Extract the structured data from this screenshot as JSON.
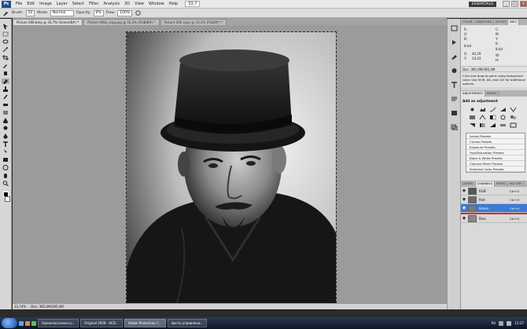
{
  "menubar": {
    "logo": "Ps",
    "items": [
      "File",
      "Edit",
      "Image",
      "Layer",
      "Select",
      "Filter",
      "Analysis",
      "3D",
      "View",
      "Window",
      "Help"
    ],
    "zoom": "33,7",
    "workspace": "ESSENTIALS",
    "window_buttons": [
      "_",
      "□",
      "×"
    ]
  },
  "options": {
    "brush_label": "Brush:",
    "brush_size": "10",
    "mode_label": "Mode:",
    "mode_value": "Normal",
    "opacity_label": "Opacity:",
    "opacity_value": "0%",
    "flow_label": "Flow:",
    "flow_value": "100%"
  },
  "tabs": [
    {
      "label": "Picture 006.bmp @ 33,7% (Green/8#) *"
    },
    {
      "label": "Picture 006a_copy.jpg @ 33,3% (RGB/8#) *"
    },
    {
      "label": "Picture 006 copy @ 33,3% (RGB/8*) *"
    }
  ],
  "status": {
    "zoom": "33,74%",
    "doc": "Doc: 385,0M/385,0M"
  },
  "panels": {
    "top_tabs": [
      "COLOR",
      "SWATCHES",
      "STYLES",
      "INFO"
    ],
    "info": {
      "r": "R:",
      "g": "G:",
      "b": "B:",
      "c": "C:",
      "m": "M:",
      "y": "Y:",
      "k": "K:",
      "bit_left": "8-bit",
      "bit_right": "8-bit",
      "x": "X:",
      "y_coord": "Y:",
      "x_val": "40,29",
      "y_val": "14,43",
      "w": "W:",
      "h": "H:"
    },
    "doc_line": "Doc: 385,0M/385,0M",
    "hint": "Click and drag to paint using foreground color. Use Shift, Alt, and Ctrl for additional options.",
    "adj_tabs": [
      "ADJUSTMENTS",
      "MASKS"
    ],
    "adj_title": "Add an adjustment",
    "presets": [
      "Levels Presets",
      "Curves Presets",
      "Exposure Presets",
      "Hue/Saturation Presets",
      "Black & White Presets",
      "Channel Mixer Presets",
      "Selective Color Presets"
    ],
    "ch_tabs": [
      "LAYERS",
      "CHANNELS",
      "PATHS",
      "HISTORY"
    ],
    "channels": [
      {
        "name": "RGB",
        "key": "Ctrl+2"
      },
      {
        "name": "Red",
        "key": "Ctrl+3"
      },
      {
        "name": "Green",
        "key": "Ctrl+4"
      },
      {
        "name": "Blue",
        "key": "Ctrl+5"
      }
    ]
  },
  "taskbar": {
    "buttons": [
      "Одноклассники.ru...",
      "Original 2008 - ACD...",
      "Adobe Photoshop C...",
      "Центр управлени..."
    ],
    "lang": "RU",
    "time": "13:37"
  }
}
